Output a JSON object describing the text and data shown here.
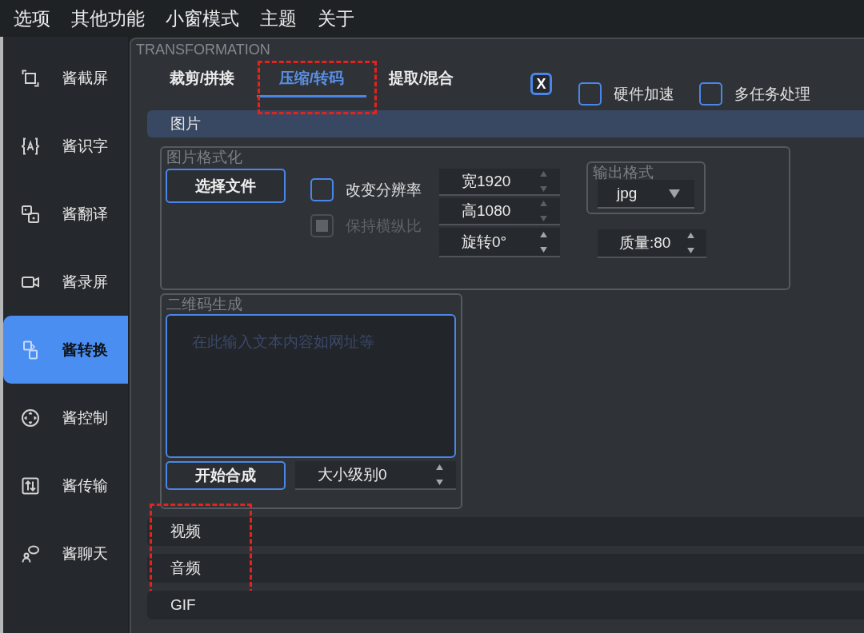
{
  "menu_bar": [
    "选项",
    "其他功能",
    "小窗模式",
    "主题",
    "关于"
  ],
  "sidebar": {
    "items": [
      {
        "label": "酱截屏",
        "selected": false
      },
      {
        "label": "酱识字",
        "selected": false
      },
      {
        "label": "酱翻译",
        "selected": false
      },
      {
        "label": "酱录屏",
        "selected": false
      },
      {
        "label": "酱转换",
        "selected": true
      },
      {
        "label": "酱控制",
        "selected": false
      },
      {
        "label": "酱传输",
        "selected": false
      },
      {
        "label": "酱聊天",
        "selected": false
      }
    ]
  },
  "panel": {
    "title": "TRANSFORMATION",
    "tabs": [
      {
        "label": "裁剪/拼接",
        "selected": false,
        "highlighted": false
      },
      {
        "label": "压缩/转码",
        "selected": true,
        "highlighted": true
      },
      {
        "label": "提取/混合",
        "selected": false,
        "highlighted": false
      }
    ],
    "x_toggle": {
      "label": "X",
      "checked": true
    },
    "options": [
      {
        "label": "硬件加速",
        "checked": false
      },
      {
        "label": "多任务处理",
        "checked": false
      }
    ],
    "sections": [
      {
        "label": "图片",
        "expanded": true,
        "highlighted": false,
        "format_group": {
          "title": "图片格式化",
          "choose_button": "选择文件",
          "checkboxes": [
            {
              "label": "改变分辨率",
              "checked": false,
              "disabled": false
            },
            {
              "label": "保持横纵比",
              "checked": true,
              "disabled": true
            }
          ],
          "spinboxes": [
            {
              "value": "宽1920",
              "disabled": true
            },
            {
              "value": "高1080",
              "disabled": true
            },
            {
              "value": "旋转0°",
              "disabled": false
            }
          ],
          "output_format": {
            "title": "输出格式",
            "value": "jpg"
          },
          "quality": {
            "value": "质量:80"
          }
        },
        "qr_group": {
          "title": "二维码生成",
          "input": {
            "placeholder": "在此输入文本内容如网址等"
          },
          "generate_button": "开始合成",
          "size_spinbox": {
            "value": "大小级别0"
          }
        }
      },
      {
        "label": "视频",
        "expanded": false,
        "highlighted": true
      },
      {
        "label": "音频",
        "expanded": false,
        "highlighted": true
      },
      {
        "label": "GIF",
        "expanded": false,
        "highlighted": false
      }
    ]
  }
}
